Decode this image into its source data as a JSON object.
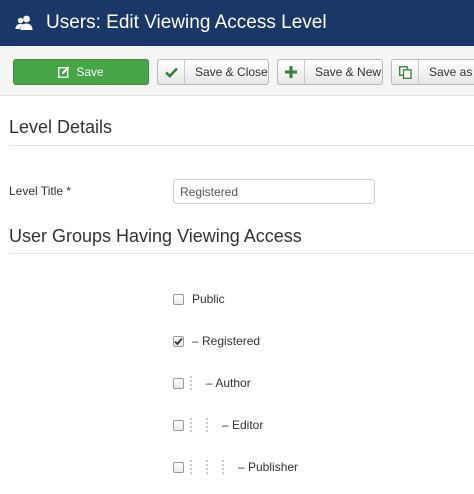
{
  "header": {
    "title": "Users: Edit Viewing Access Level",
    "icon": "users-icon",
    "background": "#1a3867"
  },
  "toolbar": {
    "save_label": "Save",
    "save_close_label": "Save & Close",
    "save_new_label": "Save & New",
    "save_copy_label": "Save as Copy",
    "save_color": "#46a546"
  },
  "details": {
    "section_title": "Level Details",
    "level_title_label": "Level Title *",
    "level_title_value": "Registered"
  },
  "groups": {
    "section_title": "User Groups Having Viewing Access",
    "items": [
      {
        "label": "Public",
        "checked": false,
        "depth": 0
      },
      {
        "label": "– Registered",
        "checked": true,
        "depth": 0
      },
      {
        "label": "– Author",
        "checked": false,
        "depth": 1
      },
      {
        "label": "– Editor",
        "checked": false,
        "depth": 2
      },
      {
        "label": "– Publisher",
        "checked": false,
        "depth": 3
      }
    ]
  }
}
